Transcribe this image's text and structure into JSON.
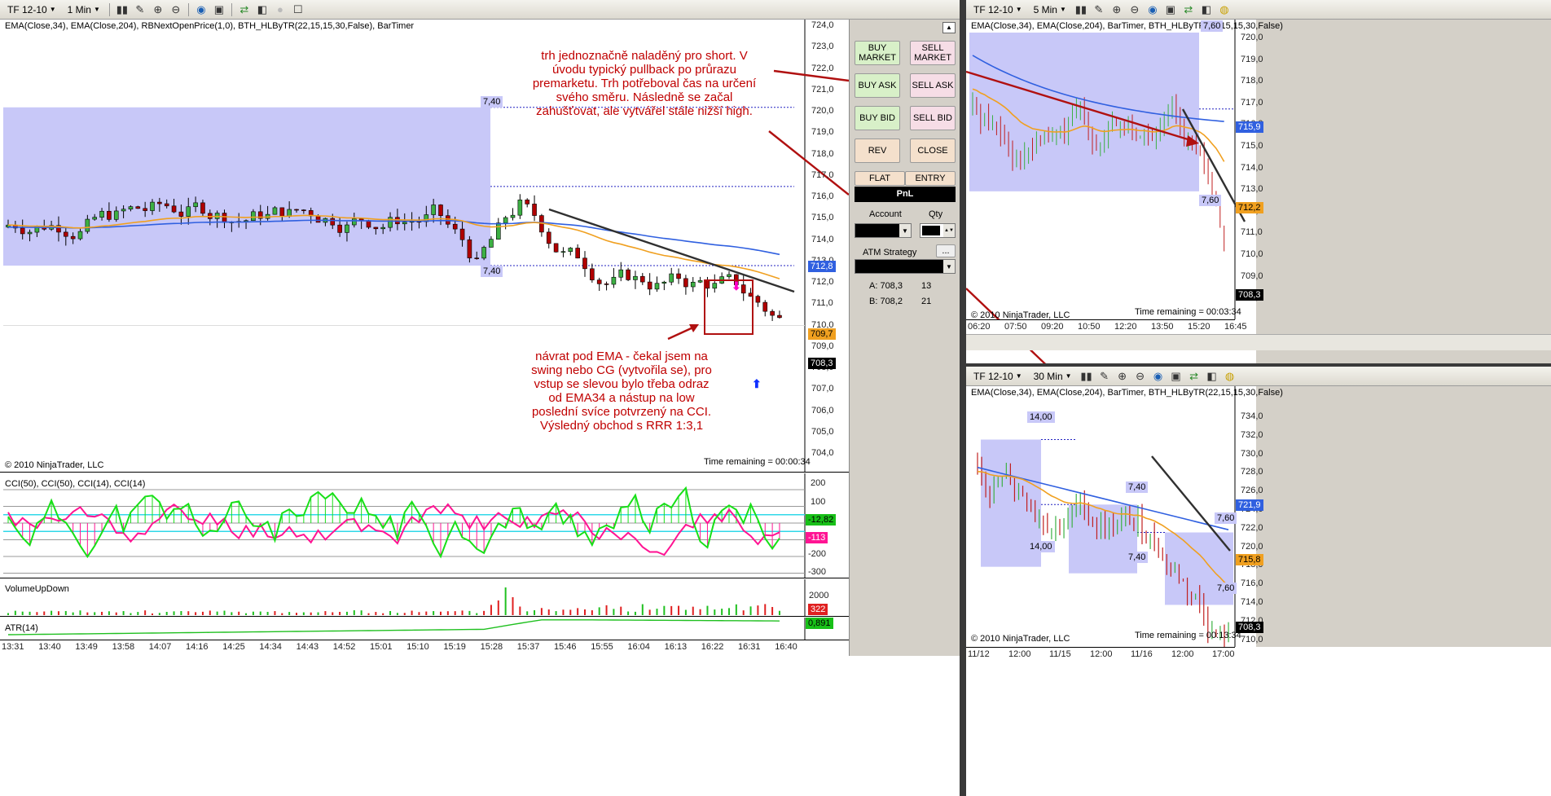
{
  "colors": {
    "panel_bg": "#d4d0c8",
    "box": "#c8c8f8",
    "ema34": "#f0a020",
    "ema204": "#3060e0",
    "trend": "#303030",
    "annot": "#c00000",
    "cci_green": "#18e018",
    "cci_pink": "#ff1493",
    "vol_green": "#20c020",
    "vol_red": "#e02020",
    "atr": "#20c020"
  },
  "main": {
    "toolbar": {
      "instrument": "TF 12-10",
      "interval": "1 Min",
      "icons": [
        "candle-style-icon",
        "draw-pencil-icon",
        "zoom-in-icon",
        "zoom-out-icon",
        "globe-icon",
        "properties-icon",
        "trade-icon",
        "chart-icon",
        "record-icon",
        "data-box-icon"
      ]
    },
    "indicators_label": "EMA(Close,34), EMA(Close,204), RBNextOpenPrice(1,0), BTH_HLByTR(22,15,15,30,False), BarTimer",
    "copyright": "© 2010 NinjaTrader, LLC",
    "time_remaining": "Time remaining = 00:00:34",
    "price_axis": [
      "724,0",
      "723,0",
      "722,0",
      "721,0",
      "720,0",
      "719,0",
      "718,0",
      "717,0",
      "716,0",
      "715,0",
      "714,0",
      "713,0",
      "712,0",
      "711,0",
      "710,0",
      "709,0",
      "708,0",
      "707,0",
      "706,0",
      "705,0",
      "704,0"
    ],
    "box_tags": [
      "7,40",
      "7,40"
    ],
    "last_tags": {
      "ema204": "712,8",
      "ema34": "709,7",
      "price": "708,3"
    },
    "cci_label": "CCI(50), CCI(50), CCI(14), CCI(14)",
    "cci_axis": [
      "200",
      "100",
      "-100",
      "-200",
      "-300"
    ],
    "cci_tags": [
      "-12,82",
      "-113"
    ],
    "vol_label": "VolumeUpDown",
    "vol_axis": [
      "2000",
      "1000"
    ],
    "vol_tag": "322",
    "atr_label": "ATR(14)",
    "atr_tag": "0,891",
    "time_axis": [
      "13:31",
      "13:40",
      "13:49",
      "13:58",
      "14:07",
      "14:16",
      "14:25",
      "14:34",
      "14:43",
      "14:52",
      "15:01",
      "15:10",
      "15:19",
      "15:28",
      "15:37",
      "15:46",
      "15:55",
      "16:04",
      "16:13",
      "16:22",
      "16:31",
      "16:40"
    ],
    "annotation1": "trh jednoznačně naladěný pro short. V úvodu typický pullback po průrazu premarketu. Trh potřeboval čas na určení svého směru. Následně se začal zahušťovat, ale vytvářel stále nižší high.",
    "annotation2": "návrat pod EMA - čekal jsem na swing nebo CG (vytvořila se), pro vstup se slevou bylo třeba odraz od EMA34 a nástup na low poslední svíce potvrzený na CCI. Výsledný obchod s RRR 1:3,1"
  },
  "order_panel": {
    "buttons": [
      {
        "label": "BUY MARKET",
        "kind": "g"
      },
      {
        "label": "SELL MARKET",
        "kind": "p"
      },
      {
        "label": "BUY ASK",
        "kind": "g"
      },
      {
        "label": "SELL ASK",
        "kind": "p"
      },
      {
        "label": "BUY BID",
        "kind": "g"
      },
      {
        "label": "SELL BID",
        "kind": "p"
      },
      {
        "label": "REV",
        "kind": "o"
      },
      {
        "label": "CLOSE",
        "kind": "o"
      }
    ],
    "flat_label": "FLAT",
    "entry_label": "ENTRY",
    "pnl_label": "PnL",
    "account_label": "Account",
    "qty_label": "Qty",
    "atm_label": "ATM Strategy",
    "more_label": "...",
    "ask": {
      "label": "A: 708,3",
      "size": "13"
    },
    "bid": {
      "label": "B: 708,2",
      "size": "21"
    }
  },
  "chart5": {
    "toolbar": {
      "instrument": "TF 12-10",
      "interval": "5 Min"
    },
    "indicators_label": "EMA(Close,34), EMA(Close,204), BarTimer, BTH_HLByTR(22,15,15,30,False)",
    "box_tags": [
      "7,60",
      "7,60"
    ],
    "price_axis": [
      "720,0",
      "719,0",
      "718,0",
      "717,0",
      "716,0",
      "715,0",
      "714,0",
      "713,0",
      "712,0",
      "711,0",
      "710,0",
      "709,0",
      "708,0"
    ],
    "last_tags": {
      "ema204": "715,9",
      "ema34": "712,2",
      "price": "708,3"
    },
    "time_axis": [
      "06:20",
      "07:50",
      "09:20",
      "10:50",
      "12:20",
      "13:50",
      "15:20",
      "16:45"
    ],
    "copyright": "© 2010 NinjaTrader, LLC",
    "time_remaining": "Time remaining = 00:03:34"
  },
  "chart30": {
    "toolbar": {
      "instrument": "TF 12-10",
      "interval": "30 Min"
    },
    "indicators_label": "EMA(Close,34), EMA(Close,204), BarTimer, BTH_HLByTR(22,15,15,30,False)",
    "box_tags": [
      "14,00",
      "14,00",
      "7,40",
      "7,40",
      "7,60",
      "7,60"
    ],
    "price_axis": [
      "734,0",
      "732,0",
      "730,0",
      "728,0",
      "726,0",
      "724,0",
      "722,0",
      "720,0",
      "718,0",
      "716,0",
      "714,0",
      "712,0",
      "710,0"
    ],
    "last_tags": {
      "ema204": "721,9",
      "ema34": "715,8",
      "price": "708,3"
    },
    "time_axis": [
      "11/12",
      "12:00",
      "11/15",
      "12:00",
      "11/16",
      "12:00",
      "17:00"
    ],
    "copyright": "© 2010 NinjaTrader, LLC",
    "time_remaining": "Time remaining = 00:13:34"
  }
}
